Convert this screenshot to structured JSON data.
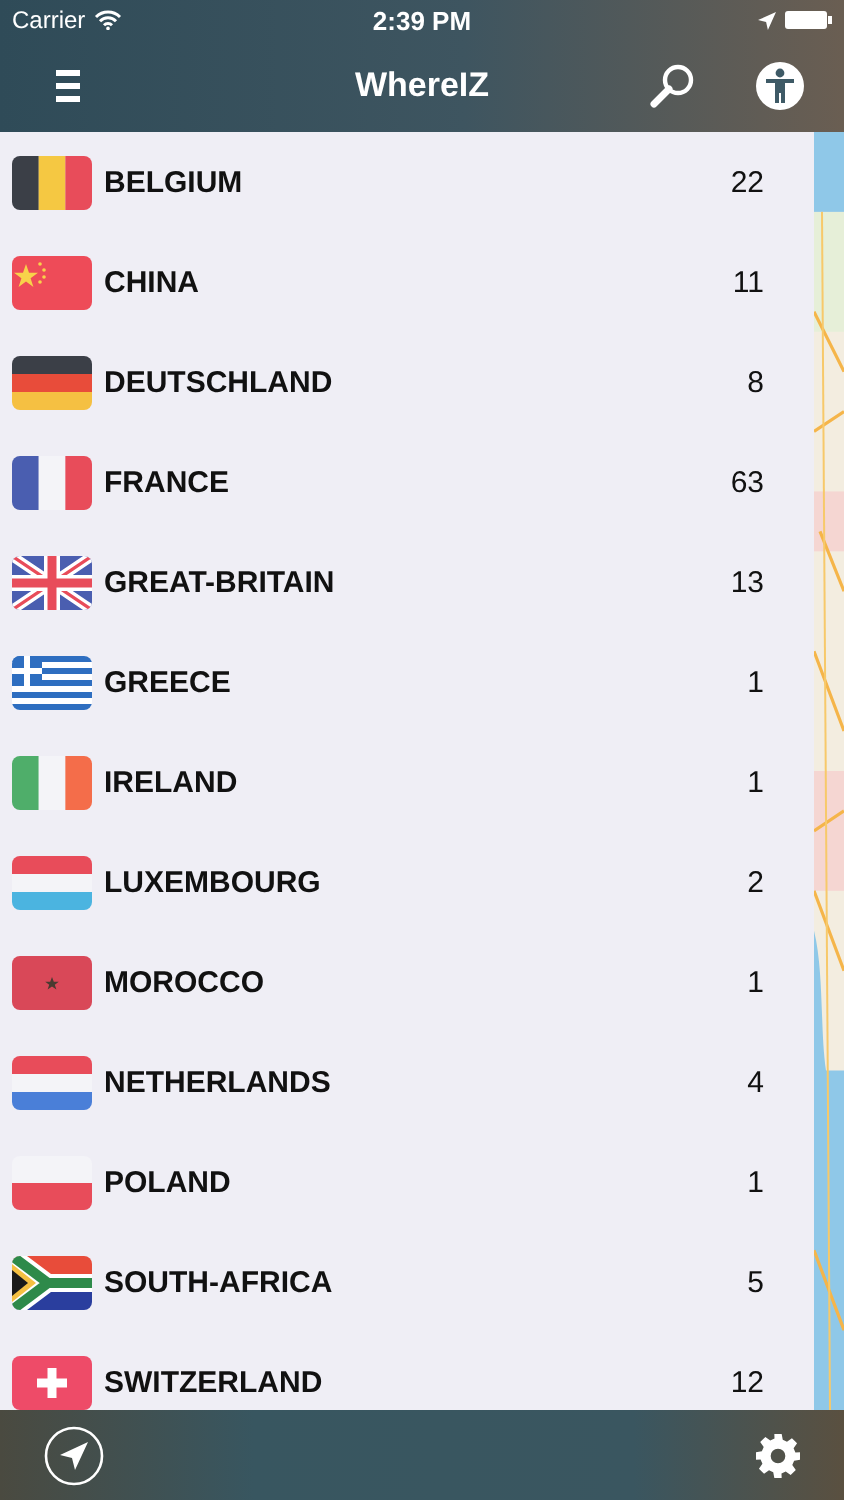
{
  "status_bar": {
    "carrier": "Carrier",
    "time": "2:39 PM"
  },
  "nav": {
    "title": "WhereIZ"
  },
  "countries": [
    {
      "name": "BELGIUM",
      "count": "22",
      "kind": "be"
    },
    {
      "name": "CHINA",
      "count": "11",
      "kind": "cn"
    },
    {
      "name": "DEUTSCHLAND",
      "count": "8",
      "kind": "de"
    },
    {
      "name": "FRANCE",
      "count": "63",
      "kind": "fr"
    },
    {
      "name": "GREAT-BRITAIN",
      "count": "13",
      "kind": "gb"
    },
    {
      "name": "GREECE",
      "count": "1",
      "kind": "gr"
    },
    {
      "name": "IRELAND",
      "count": "1",
      "kind": "ie"
    },
    {
      "name": "LUXEMBOURG",
      "count": "2",
      "kind": "lu"
    },
    {
      "name": "MOROCCO",
      "count": "1",
      "kind": "ma"
    },
    {
      "name": "NETHERLANDS",
      "count": "4",
      "kind": "nl"
    },
    {
      "name": "POLAND",
      "count": "1",
      "kind": "pl"
    },
    {
      "name": "SOUTH-AFRICA",
      "count": "5",
      "kind": "za"
    },
    {
      "name": "SWITZERLAND",
      "count": "12",
      "kind": "ch"
    }
  ]
}
